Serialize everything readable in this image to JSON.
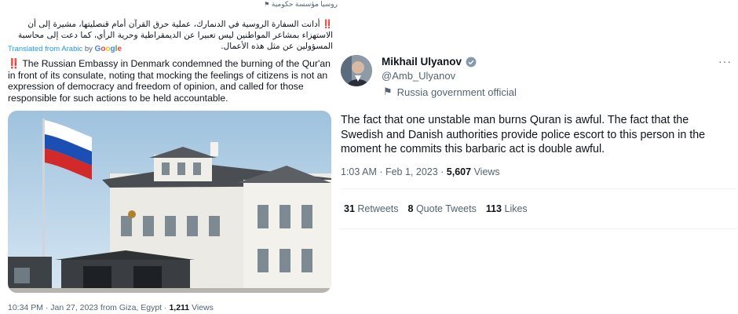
{
  "left_tweet": {
    "state_media_label": "روسيا مؤسسة حكومية",
    "arabic_text": "أدانت السفارة الروسية في الدنمارك، عملية حرق القرآن أمام قنصليتها، مشيرة إلى أن الاستهزاء بمشاعر المواطنين ليس تعبيرا عن الديمقراطية وحرية الرأي، كما دعت إلى محاسبة المسؤولين عن مثل هذه الأعمال.",
    "alert_glyph": "‼️",
    "translated_label": "Translated from Arabic",
    "translated_by": "by",
    "google_brand": "Google",
    "english_text": "The Russian Embassy in Denmark condemned the burning of the Qur'an in front of its consulate, noting that mocking the feelings of citizens is not an expression of democracy and freedom of opinion, and called for those responsible for such actions to be held accountable.",
    "meta_time": "10:34 PM · Jan 27, 2023 from Giza, Egypt · ",
    "views_count": "1,211",
    "views_label": "Views"
  },
  "right_tweet": {
    "author_name": "Mikhail Ulyanov",
    "handle": "@Amb_Ulyanov",
    "gov_label": "Russia government official",
    "more_glyph": "···",
    "text": "The fact that one unstable man burns Quran is awful. The fact that the Swedish and Danish authorities provide police escort to this person in the moment he commits this barbaric act is double awful.",
    "meta_time": "1:03 AM · Feb 1, 2023 · ",
    "views_count": "5,607",
    "views_label": "Views",
    "retweets_count": "31",
    "retweets_label": "Retweets",
    "quotes_count": "8",
    "quotes_label": "Quote Tweets",
    "likes_count": "113",
    "likes_label": "Likes"
  },
  "colors": {
    "accent": "#1d9bf0",
    "muted": "#536471",
    "alert": "#e0245e"
  },
  "icons": [
    "flag-icon",
    "verified-badge-icon",
    "more-options-icon",
    "google-logo-icon"
  ]
}
